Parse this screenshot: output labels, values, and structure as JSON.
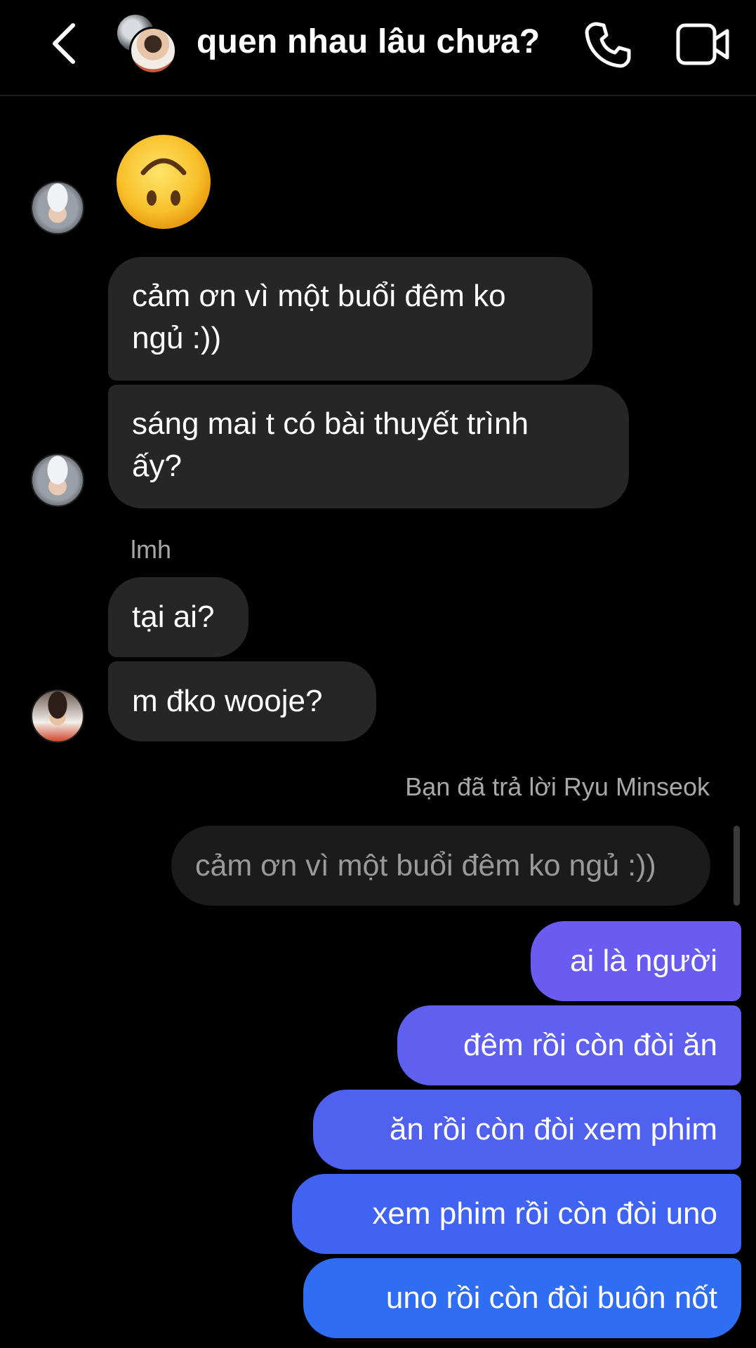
{
  "header": {
    "title": "quen nhau lâu chưa?",
    "back_icon": "chevron-left-icon",
    "call_icon": "phone-icon",
    "video_icon": "video-camera-icon"
  },
  "colors": {
    "background": "#000000",
    "incoming_bubble": "#262626",
    "quoted_bubble": "#1b1b1b",
    "outgoing_gradient_top": "#6a5cf0",
    "outgoing_gradient_bottom": "#2f6df2",
    "muted_text": "#a8a8a8"
  },
  "messages": {
    "emoji": "🙃",
    "in1": "cảm ơn vì một buổi đêm ko",
    "in1b": "ngủ :))",
    "in2": "sáng mai t có bài thuyết trình",
    "in2b": "ấy?",
    "sender_label": "lmh",
    "in3": "tại ai?",
    "in4": "m đko wooje?",
    "reply_label": "Bạn đã trả lời Ryu Minseok",
    "quoted": "cảm ơn vì một buổi đêm ko ngủ :))",
    "out1": "ai là người",
    "out2": "đêm rồi còn đòi ăn",
    "out3": "ăn rồi còn đòi xem phim",
    "out4": "xem phim rồi còn đòi uno",
    "out5": "uno rồi còn đòi buôn nốt"
  }
}
